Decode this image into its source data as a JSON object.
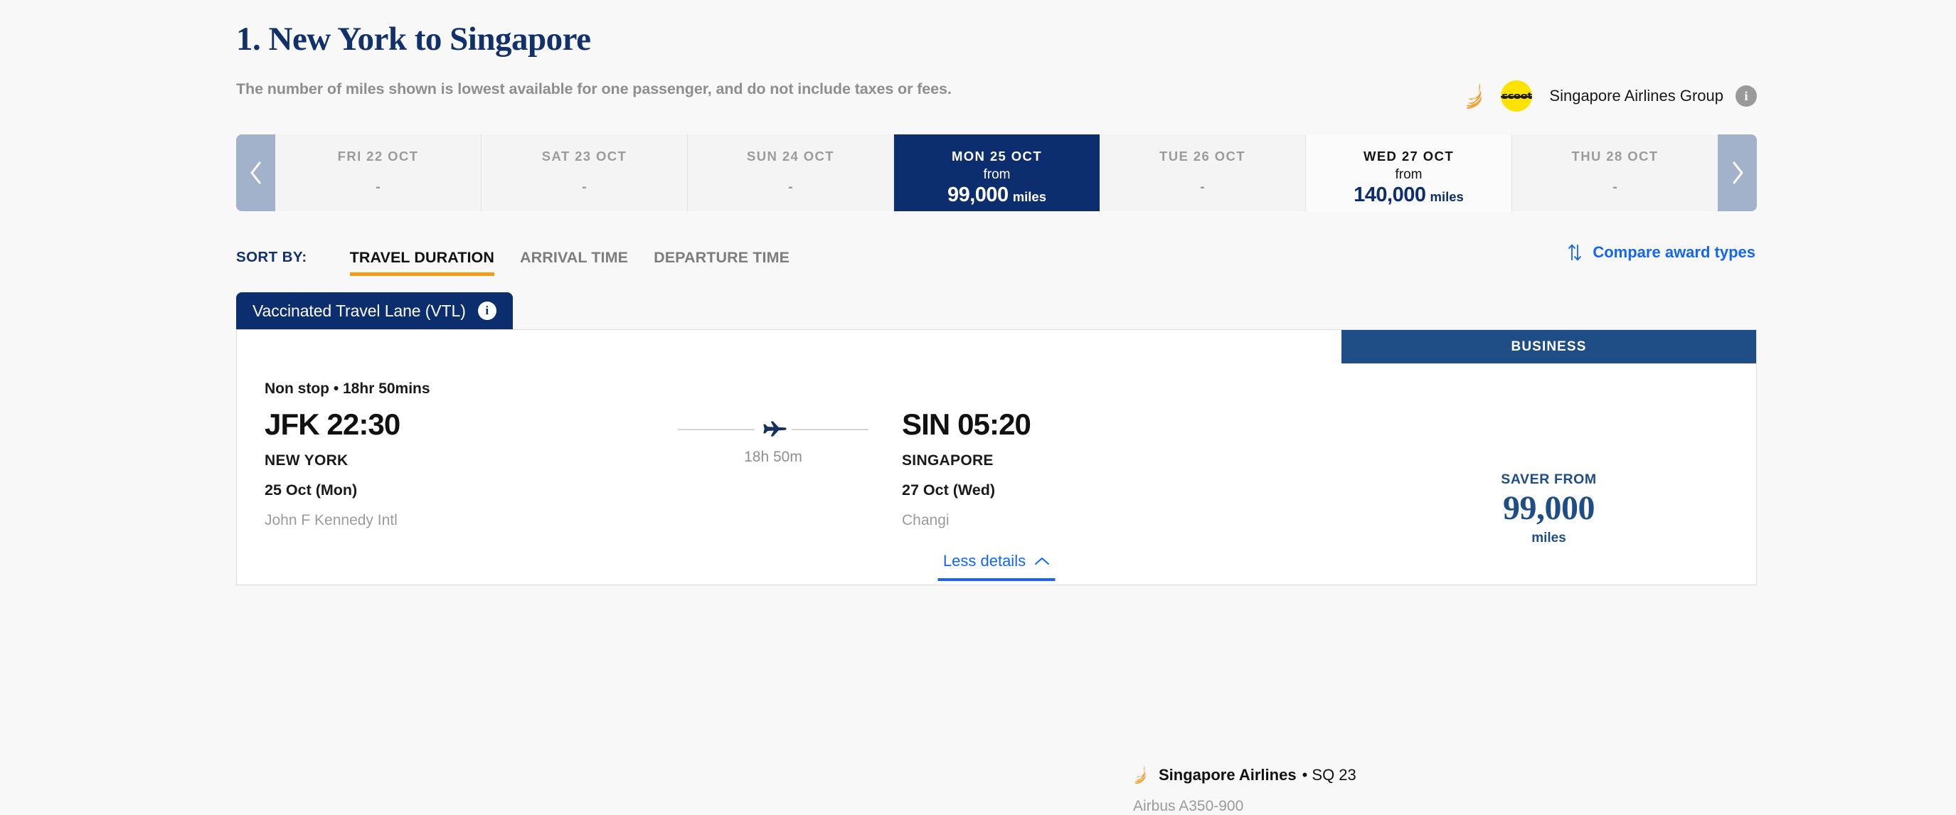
{
  "header": {
    "title": "1. New York to Singapore",
    "subtitle": "The number of miles shown is lowest available for one passenger, and do not include taxes or fees.",
    "group_name": "Singapore Airlines Group",
    "group_info_char": "i",
    "scoot_label": "scoot"
  },
  "datestrip": {
    "prev_label": "Previous dates",
    "next_label": "Next dates",
    "cells": [
      {
        "label": "FRI 22 OCT",
        "value": "-",
        "from_label": "",
        "miles": "",
        "unit": "",
        "state": "empty"
      },
      {
        "label": "SAT 23 OCT",
        "value": "-",
        "from_label": "",
        "miles": "",
        "unit": "",
        "state": "empty"
      },
      {
        "label": "SUN 24 OCT",
        "value": "-",
        "from_label": "",
        "miles": "",
        "unit": "",
        "state": "empty"
      },
      {
        "label": "MON 25 OCT",
        "value": "",
        "from_label": "from",
        "miles": "99,000",
        "unit": "miles",
        "state": "selected"
      },
      {
        "label": "TUE 26 OCT",
        "value": "-",
        "from_label": "",
        "miles": "",
        "unit": "",
        "state": "empty"
      },
      {
        "label": "WED 27 OCT",
        "value": "",
        "from_label": "from",
        "miles": "140,000",
        "unit": "miles",
        "state": "available"
      },
      {
        "label": "THU 28 OCT",
        "value": "-",
        "from_label": "",
        "miles": "",
        "unit": "",
        "state": "empty"
      }
    ]
  },
  "sort": {
    "label": "SORT BY:",
    "options": [
      {
        "label": "TRAVEL DURATION",
        "active": true
      },
      {
        "label": "ARRIVAL TIME",
        "active": false
      },
      {
        "label": "DEPARTURE TIME",
        "active": false
      }
    ],
    "compare_label": "Compare award types"
  },
  "vtl": {
    "label": "Vaccinated Travel Lane (VTL)",
    "info_char": "i"
  },
  "flight": {
    "cabin": "BUSINESS",
    "stops": "Non stop • 18hr 50mins",
    "departure": {
      "code_time": "JFK 22:30",
      "city": "NEW YORK",
      "date": "25 Oct (Mon)",
      "airport": "John F Kennedy Intl"
    },
    "arrival": {
      "code_time": "SIN 05:20",
      "city": "SINGAPORE",
      "date": "27 Oct (Wed)",
      "airport": "Changi"
    },
    "duration": "18h 50m",
    "airline_name": "Singapore Airlines",
    "flight_number": "• SQ 23",
    "aircraft": "Airbus A350-900",
    "fare_label": "SAVER FROM",
    "fare_miles": "99,000",
    "fare_unit": "miles",
    "less_details_label": "Less details"
  },
  "colors": {
    "navy_dark": "#0c2e6e",
    "navy_mid": "#1f4d85",
    "title_navy": "#12316b",
    "orange_accent": "#f59b18",
    "link_blue": "#1466f0",
    "sia_orange": "#f5a033",
    "scoot_yellow": "#ffe300",
    "muted_gray": "#9b9b9b",
    "page_bg": "#f8f8f8"
  }
}
